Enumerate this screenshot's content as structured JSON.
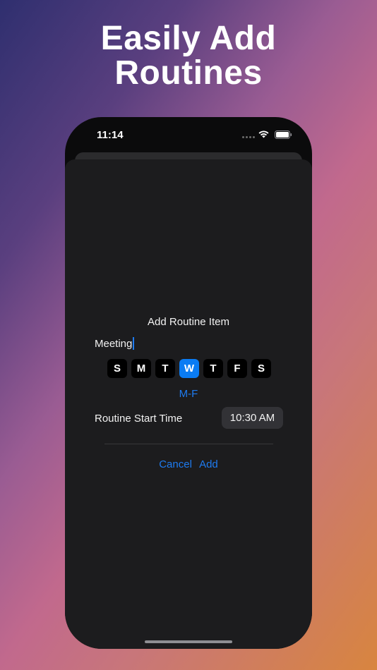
{
  "headline": {
    "line1": "Easily Add",
    "line2": "Routines"
  },
  "status_bar": {
    "time": "11:14"
  },
  "dialog": {
    "title": "Add Routine Item",
    "name_value": "Meeting",
    "days": [
      {
        "label": "S",
        "selected": false
      },
      {
        "label": "M",
        "selected": false
      },
      {
        "label": "T",
        "selected": false
      },
      {
        "label": "W",
        "selected": true
      },
      {
        "label": "T",
        "selected": false
      },
      {
        "label": "F",
        "selected": false
      },
      {
        "label": "S",
        "selected": false
      }
    ],
    "preset_label": "M-F",
    "start_time_label": "Routine Start Time",
    "start_time_value": "10:30 AM",
    "cancel_label": "Cancel",
    "add_label": "Add"
  },
  "colors": {
    "accent": "#0a7cf4",
    "sheet": "#1c1c1e",
    "day_bg": "#000000"
  },
  "icons": [
    "cellular-icon",
    "wifi-icon",
    "battery-icon"
  ]
}
